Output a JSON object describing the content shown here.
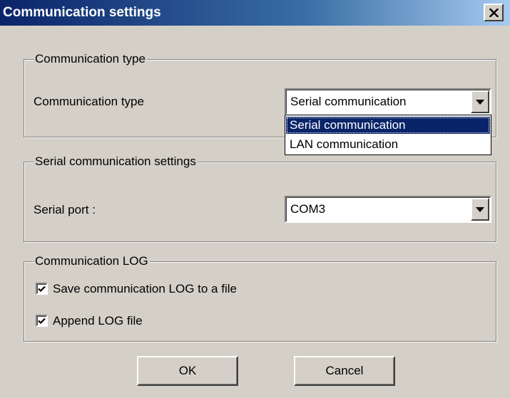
{
  "window": {
    "title": "Communication settings",
    "close_icon": "close-icon"
  },
  "comm_type_group": {
    "legend": "Communication type",
    "label": "Communication type",
    "selected_value": "Serial communication",
    "dropdown_open": true,
    "options": [
      {
        "label": "Serial communication",
        "selected": true
      },
      {
        "label": "LAN communication",
        "selected": false
      }
    ]
  },
  "serial_group": {
    "legend": "Serial communication settings",
    "port_label": "Serial port :",
    "port_value": "COM3"
  },
  "log_group": {
    "legend": "Communication LOG",
    "save_log": {
      "label": "Save communication LOG to a file",
      "checked": true
    },
    "append_log": {
      "label": "Append LOG file",
      "checked": true
    }
  },
  "buttons": {
    "ok_label": "OK",
    "cancel_label": "Cancel"
  },
  "colors": {
    "title_bar_start": "#0a246a",
    "title_bar_end": "#a6caf0",
    "dialog_face": "#d4d0c8",
    "selection_highlight": "#0a246a"
  }
}
